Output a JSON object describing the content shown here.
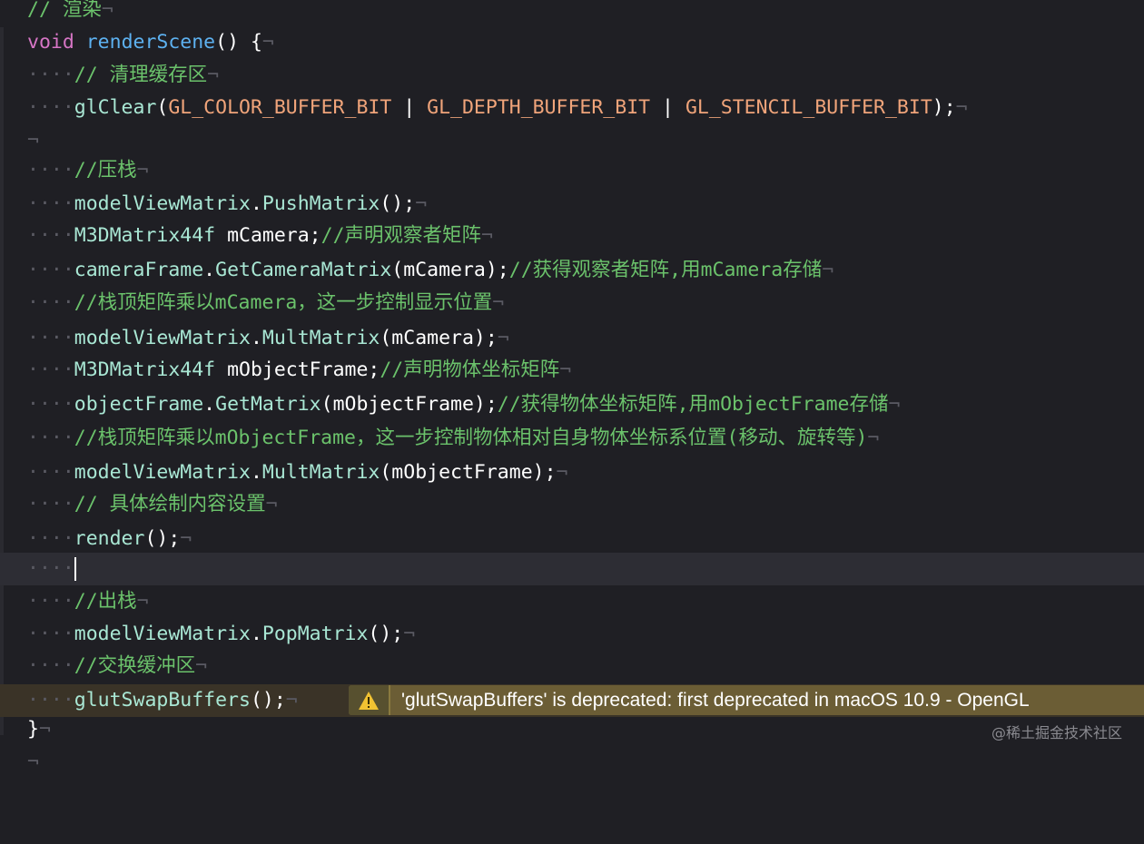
{
  "top_comment": "// 渲染",
  "func_keyword": "void",
  "func_name": "renderScene",
  "func_rest": "() {",
  "comment_clear": "// 清理缓存区",
  "glclear_fn": "glClear",
  "glclear_open": "(",
  "color_bit": "GL_COLOR_BUFFER_BIT",
  "pipe": " | ",
  "depth_bit": "GL_DEPTH_BUFFER_BIT",
  "stencil_bit": "GL_STENCIL_BUFFER_BIT",
  "close_semi": ");",
  "comment_push": "//压栈",
  "mvm": "modelViewMatrix",
  "push_matrix": "PushMatrix",
  "empty_call": "();",
  "m3d_type": "M3DMatrix44f",
  "m_camera_decl": " mCamera;",
  "comment_declare_observer": "//声明观察者矩阵",
  "camera_frame": "cameraFrame",
  "get_camera_matrix": "GetCameraMatrix",
  "m_camera_arg": "(mCamera);",
  "comment_get_observer": "//获得观察者矩阵,用mCamera存储",
  "comment_mult_camera": "//栈顶矩阵乘以mCamera，这一步控制显示位置",
  "mult_matrix": "MultMatrix",
  "m_object_frame_decl": " mObjectFrame;",
  "comment_declare_object": "//声明物体坐标矩阵",
  "object_frame": "objectFrame",
  "get_matrix": "GetMatrix",
  "m_object_frame_arg": "(mObjectFrame);",
  "comment_get_object": "//获得物体坐标矩阵,用mObjectFrame存储",
  "comment_mult_object": "//栈顶矩阵乘以mObjectFrame，这一步控制物体相对自身物体坐标系位置(移动、旋转等)",
  "comment_render": "// 具体绘制内容设置",
  "render_fn": "render",
  "comment_pop": "//出栈",
  "pop_matrix": "PopMatrix",
  "comment_swap": "//交换缓冲区",
  "glut_swap": "glutSwapBuffers",
  "closing_brace": "}",
  "dot": ".",
  "indent": "····",
  "newline_mark": "¬",
  "warning": {
    "icon": "warning-triangle-icon",
    "text": "'glutSwapBuffers' is deprecated: first deprecated in macOS 10.9 - OpenGL"
  },
  "watermark": "@稀土掘金技术社区",
  "colors": {
    "background": "#1f1f24",
    "comment": "#6bc26b",
    "keyword": "#d675c5",
    "identifier": "#a9e7d4",
    "constant": "#f0a47a",
    "warning_bg": "#6b5d35"
  }
}
